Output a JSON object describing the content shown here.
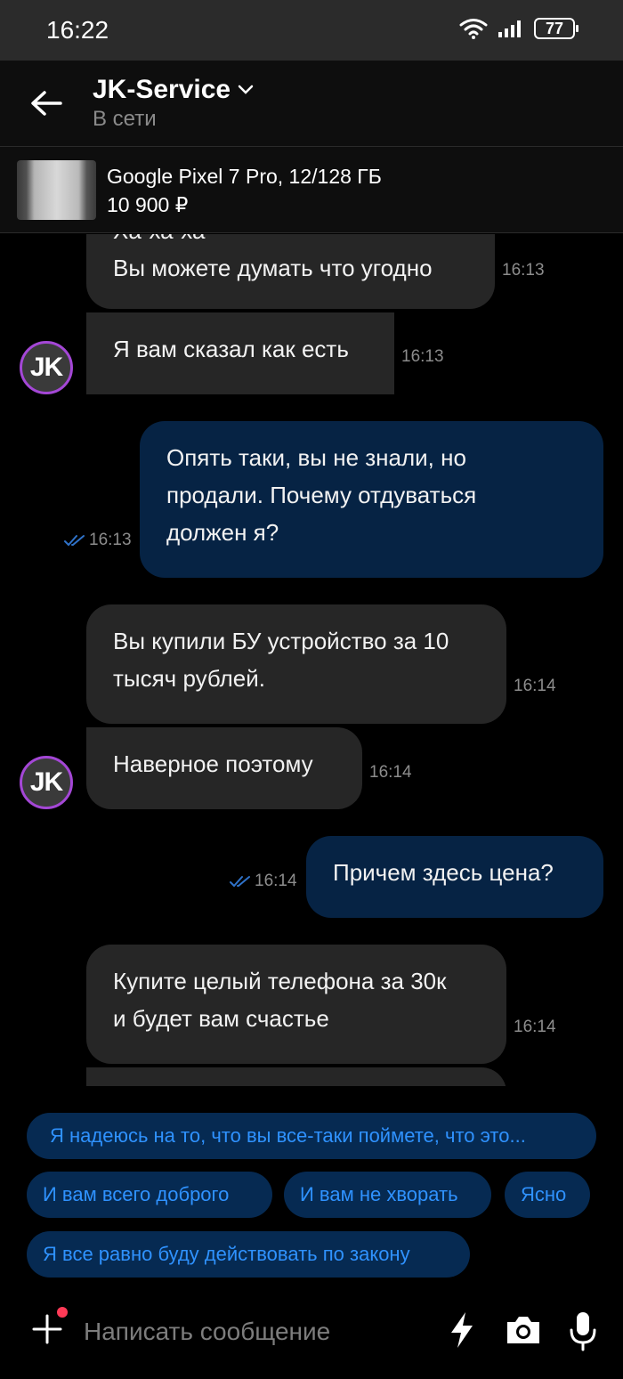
{
  "status_bar": {
    "time": "16:22",
    "battery": "77"
  },
  "header": {
    "contact_name": "JK-Service",
    "contact_status": "В сети"
  },
  "listing": {
    "title": "Google Pixel 7 Pro, 12/128 ГБ",
    "price": "10 900 ₽"
  },
  "messages": [
    {
      "direction": "in",
      "text_partial": "Ха-ха-ха",
      "text": "Вы можете думать что угодно",
      "time": "16:13"
    },
    {
      "direction": "in",
      "text": "Я вам сказал как есть",
      "time": "16:13",
      "avatar": "JK"
    },
    {
      "direction": "out",
      "lines": [
        "Опять таки, вы не знали, но",
        "продали. Почему отдуваться",
        "должен я?"
      ],
      "time": "16:13",
      "read": true
    },
    {
      "direction": "in",
      "lines": [
        "Вы купили БУ устройство за 10",
        "тысяч рублей."
      ],
      "time": "16:14"
    },
    {
      "direction": "in",
      "text": "Наверное поэтому",
      "time": "16:14",
      "avatar": "JK"
    },
    {
      "direction": "out",
      "text": "Причем здесь цена?",
      "time": "16:14",
      "read": true
    },
    {
      "direction": "in",
      "lines": [
        "Купите целый телефона за 30к",
        "и будет вам счастье"
      ],
      "time": "16:14"
    }
  ],
  "quick_replies": [
    "Я надеюсь на то, что вы все-таки поймете, что это...",
    "И вам всего доброго",
    "И вам не хворать",
    "Ясно",
    "Я все равно буду действовать по закону"
  ],
  "composer": {
    "placeholder": "Написать сообщение"
  },
  "colors": {
    "accent": "#2f92ff",
    "chip_bg": "#062a52",
    "out_bubble": "#062344",
    "in_bubble": "#262626",
    "avatar_ring": "#a447d6",
    "badge_dot": "#ff3a57"
  }
}
